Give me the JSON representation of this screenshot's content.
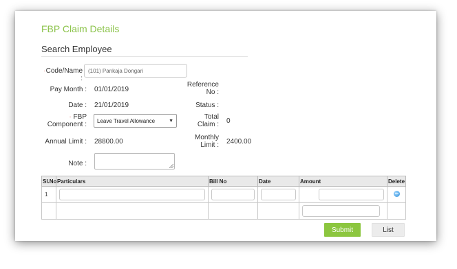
{
  "page": {
    "title": "FBP Claim Details",
    "section_title": "Search Employee"
  },
  "form": {
    "code_name": {
      "label": "Code/Name :",
      "value": "(101) Pankaja Dongari"
    },
    "pay_month": {
      "label": "Pay Month :",
      "value": "01/01/2019"
    },
    "date": {
      "label": "Date :",
      "value": "21/01/2019"
    },
    "fbp_component": {
      "label_line1": "FBP",
      "label_line2": "Component :",
      "selected": "Leave Travel Allowance"
    },
    "annual_limit": {
      "label": "Annual Limit :",
      "value": "28800.00"
    },
    "note": {
      "label": "Note :",
      "value": ""
    },
    "reference_no": {
      "label_line1": "Reference",
      "label_line2": "No :",
      "value": ""
    },
    "status": {
      "label": "Status :",
      "value": ""
    },
    "total_claim": {
      "label_line1": "Total",
      "label_line2": "Claim :",
      "value": "0"
    },
    "monthly_limit": {
      "label_line1": "Monthly",
      "label_line2": "Limit :",
      "value": "2400.00"
    }
  },
  "table": {
    "headers": [
      "Sl.No",
      "Particulars",
      "Bill No",
      "Date",
      "Amount",
      "Delete"
    ],
    "rows": [
      {
        "sl_no": "1"
      }
    ]
  },
  "actions": {
    "submit_label": "Submit",
    "list_label": "List"
  },
  "colors": {
    "accent": "#8bc34a",
    "required": "#e05a4f",
    "submit_bg": "#8cc63f"
  }
}
